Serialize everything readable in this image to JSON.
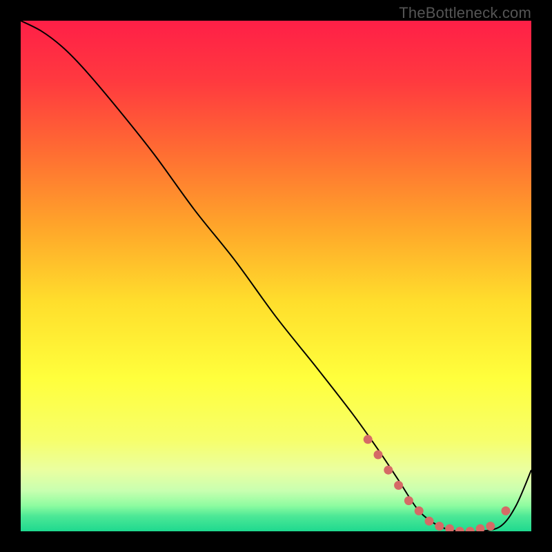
{
  "watermark": "TheBottleneck.com",
  "gradient": {
    "stops": [
      {
        "pct": 0,
        "color": "#ff1f47"
      },
      {
        "pct": 12,
        "color": "#ff3a3f"
      },
      {
        "pct": 25,
        "color": "#ff6a33"
      },
      {
        "pct": 40,
        "color": "#ffa42a"
      },
      {
        "pct": 55,
        "color": "#ffde2c"
      },
      {
        "pct": 70,
        "color": "#ffff3c"
      },
      {
        "pct": 82,
        "color": "#f7ff6a"
      },
      {
        "pct": 88,
        "color": "#eaffa0"
      },
      {
        "pct": 92,
        "color": "#c9ffb0"
      },
      {
        "pct": 95,
        "color": "#8dfca0"
      },
      {
        "pct": 97,
        "color": "#4de896"
      },
      {
        "pct": 100,
        "color": "#1ed98f"
      }
    ]
  },
  "chart_data": {
    "type": "line",
    "title": "",
    "xlabel": "",
    "ylabel": "",
    "xlim": [
      0,
      100
    ],
    "ylim": [
      0,
      100
    ],
    "series": [
      {
        "name": "curve",
        "x": [
          0,
          4,
          8,
          12,
          18,
          26,
          34,
          42,
          50,
          58,
          65,
          70,
          74,
          78,
          82,
          86,
          90,
          94,
          97,
          100
        ],
        "y": [
          100,
          98,
          95,
          91,
          84,
          74,
          63,
          53,
          42,
          32,
          23,
          16,
          10,
          4,
          1,
          0,
          0,
          1,
          5,
          12
        ]
      }
    ],
    "markers": {
      "name": "highlight-points",
      "x": [
        68,
        70,
        72,
        74,
        76,
        78,
        80,
        82,
        84,
        86,
        88,
        90,
        92,
        95
      ],
      "y": [
        18,
        15,
        12,
        9,
        6,
        4,
        2,
        1,
        0.5,
        0,
        0,
        0.5,
        1,
        4
      ]
    }
  }
}
